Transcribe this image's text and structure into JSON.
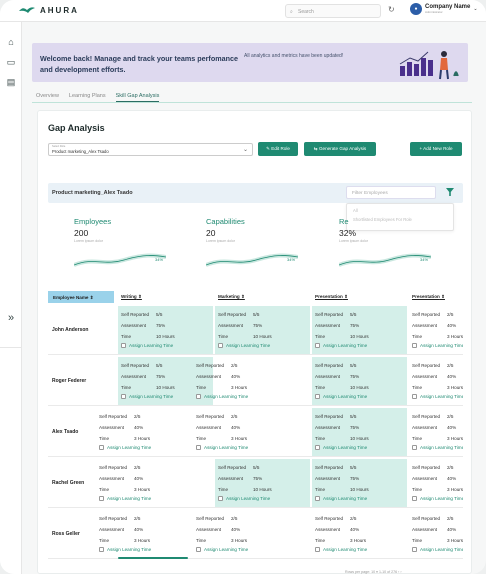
{
  "app": {
    "logo": "AHURA"
  },
  "topbar": {
    "search_placeholder": "Search",
    "company_name": "Company Name",
    "company_sub": "Administrator",
    "avatar_initial": ""
  },
  "banner": {
    "title": "Welcome back! Manage and track your teams perfomance and development efforts.",
    "message": "All analytics and metrics have been updated!"
  },
  "tabs": [
    {
      "label": "Overview",
      "active": false
    },
    {
      "label": "Learning Plans",
      "active": false
    },
    {
      "label": "Skill Gap Analysis",
      "active": true
    }
  ],
  "gap": {
    "title": "Gap Analysis",
    "select_label": "Select Role",
    "select_value": "Product marketing_Alex Tsado",
    "edit_role": "Edit Role",
    "generate": "Generate Gap Analysis",
    "add_role": "+ Add New Role",
    "filter_name": "Product marketing_Alex Tsado",
    "filter_placeholder": "Filter Employees",
    "filter_options": [
      "All",
      "Shortlisted Employees For Role"
    ]
  },
  "stats": [
    {
      "label": "Employees",
      "value": "200",
      "desc": "Lorem ipsum dolor",
      "pct": "34%"
    },
    {
      "label": "Capabilities",
      "value": "20",
      "desc": "Lorem ipsum dolor",
      "pct": "34%"
    },
    {
      "label": "Re",
      "value": "32%",
      "desc": "Lorem ipsum dolor",
      "pct": "34%"
    }
  ],
  "table": {
    "headers": [
      "Employee Name",
      "Writing",
      "Marketing",
      "Presentation",
      "Presentation"
    ],
    "row_labels": {
      "self": "Self Reported",
      "assess": "Assessment",
      "time": "Time",
      "assign": "Assign Learning Time"
    },
    "rows": [
      {
        "name": "John Anderson",
        "cells": [
          {
            "self": "5/5",
            "assess": "75%",
            "time": "10 Hours",
            "hi": true
          },
          {
            "self": "5/5",
            "assess": "75%",
            "time": "10 Hours",
            "hi": true
          },
          {
            "self": "5/5",
            "assess": "75%",
            "time": "10 Hours",
            "hi": true
          },
          {
            "self": "2/5",
            "assess": "40%",
            "time": "3 Hours",
            "hi": false
          }
        ]
      },
      {
        "name": "Roger Federer",
        "cells": [
          {
            "self": "5/5",
            "assess": "75%",
            "time": "10 Hours",
            "hi": true
          },
          {
            "self": "2/5",
            "assess": "40%",
            "time": "3 Hours",
            "hi": false
          },
          {
            "self": "5/5",
            "assess": "75%",
            "time": "10 Hours",
            "hi": true
          },
          {
            "self": "2/5",
            "assess": "40%",
            "time": "3 Hours",
            "hi": false
          }
        ]
      },
      {
        "name": "Alex Tsado",
        "cells": [
          {
            "self": "2/5",
            "assess": "40%",
            "time": "3 Hours",
            "hi": false
          },
          {
            "self": "2/5",
            "assess": "40%",
            "time": "3 Hours",
            "hi": false
          },
          {
            "self": "5/5",
            "assess": "75%",
            "time": "10 Hours",
            "hi": true
          },
          {
            "self": "2/5",
            "assess": "40%",
            "time": "3 Hours",
            "hi": false
          }
        ]
      },
      {
        "name": "Rachel Green",
        "cells": [
          {
            "self": "2/5",
            "assess": "40%",
            "time": "3 Hours",
            "hi": false
          },
          {
            "self": "5/5",
            "assess": "75%",
            "time": "10 Hours",
            "hi": true
          },
          {
            "self": "5/5",
            "assess": "75%",
            "time": "10 Hours",
            "hi": true
          },
          {
            "self": "2/5",
            "assess": "40%",
            "time": "3 Hours",
            "hi": false
          }
        ]
      },
      {
        "name": "Ross Geller",
        "cells": [
          {
            "self": "2/5",
            "assess": "40%",
            "time": "3 Hours",
            "hi": false
          },
          {
            "self": "2/5",
            "assess": "40%",
            "time": "3 Hours",
            "hi": false
          },
          {
            "self": "2/5",
            "assess": "40%",
            "time": "3 Hours",
            "hi": false
          },
          {
            "self": "2/5",
            "assess": "40%",
            "time": "3 Hours",
            "hi": false
          }
        ]
      }
    ]
  },
  "pager": {
    "text": "Rows per page: 10  ▾     1-10 of 276  ‹  ›"
  },
  "colors": {
    "accent": "#1f8a72",
    "highlight": "#d4efe9",
    "banner": "#ded9ef"
  }
}
